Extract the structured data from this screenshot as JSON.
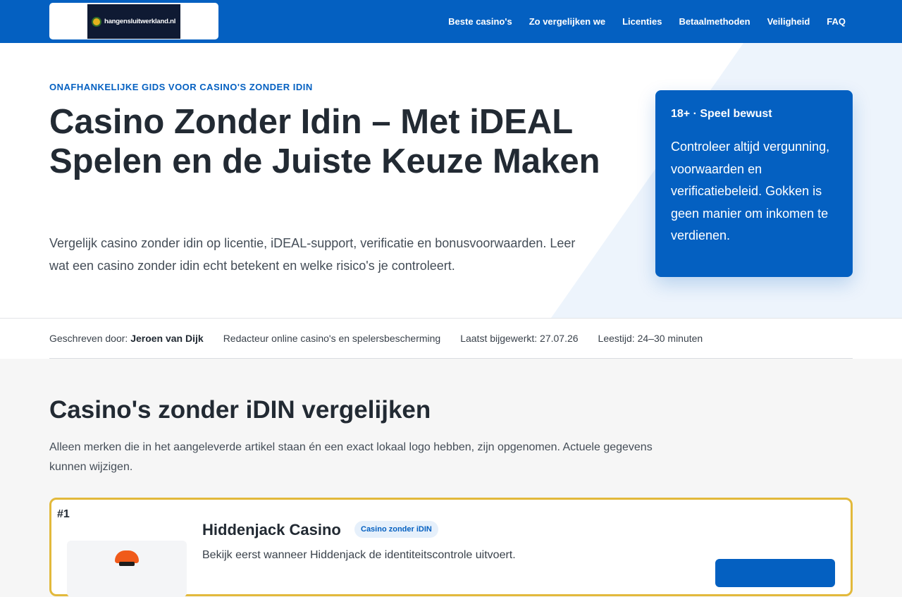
{
  "header": {
    "logo_text": "hangensluitwerkland.nl",
    "nav": [
      "Beste casino's",
      "Zo vergelijken we",
      "Licenties",
      "Betaalmethoden",
      "Veiligheid",
      "FAQ"
    ]
  },
  "hero": {
    "eyebrow": "Onafhankelijke gids voor casino's zonder iDIN",
    "title": "Casino Zonder Idin – Met iDEAL Spelen en de Juiste Keuze Maken",
    "lead": "Vergelijk casino zonder idin op licentie, iDEAL-support, verificatie en bonusvoorwaarden. Leer wat een casino zonder idin echt betekent en welke risico's je controleert.",
    "rg_card": {
      "title": "18+ · Speel bewust",
      "text": "Controleer altijd vergunning, voorwaarden en verificatiebeleid. Gokken is geen manier om inkomen te verdienen."
    }
  },
  "meta": {
    "author_label": "Geschreven door:",
    "author_name": "Jeroen van Dijk",
    "role": "Redacteur online casino's en spelersbescherming",
    "updated": "Laatst bijgewerkt: 27.07.26",
    "reading_time": "Leestijd: 24–30 minuten"
  },
  "comparison": {
    "title": "Casino's zonder iDIN vergelijken",
    "intro": "Alleen merken die in het aangeleverde artikel staan én een exact lokaal logo hebben, zijn opgenomen. Actuele gegevens kunnen wijzigen.",
    "cards": [
      {
        "rank": "#1",
        "name": "Hiddenjack Casino",
        "badge": "Casino zonder iDIN",
        "description": "Bekijk eerst wanneer Hiddenjack de identiteitscontrole uitvoert."
      }
    ]
  },
  "colors": {
    "brand_blue": "#0460c1",
    "featured_border": "#e2b93b",
    "text_dark": "#222a33"
  }
}
